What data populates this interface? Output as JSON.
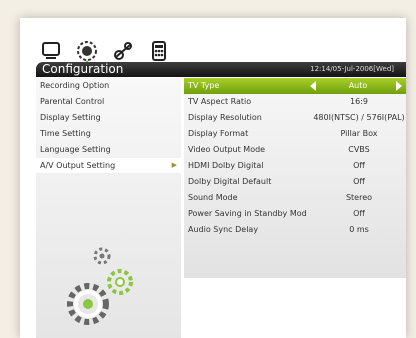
{
  "header": {
    "title": "Configuration",
    "datetime": "12:14/05-Jul-2006[Wed]"
  },
  "icons": [
    "tv-icon",
    "satellite-dish-icon",
    "settings-gear-icon",
    "calculator-icon"
  ],
  "left_menu": {
    "items": [
      {
        "label": "Recording Option"
      },
      {
        "label": "Parental Control"
      },
      {
        "label": "Display Setting"
      },
      {
        "label": "Time Setting"
      },
      {
        "label": "Language Setting"
      },
      {
        "label": "A/V Output Setting",
        "active": true,
        "arrow": "▶"
      }
    ]
  },
  "settings": {
    "rows": [
      {
        "label": "TV Type",
        "value": "Auto",
        "selected": true
      },
      {
        "label": "TV Aspect Ratio",
        "value": "16:9"
      },
      {
        "label": "Display Resolution",
        "value": "480I(NTSC) / 576I(PAL)"
      },
      {
        "label": "Display Format",
        "value": "Pillar Box"
      },
      {
        "label": "Video Output Mode",
        "value": "CVBS"
      },
      {
        "label": "HDMI Dolby Digital",
        "value": "Off"
      },
      {
        "label": "Dolby Digital Default",
        "value": "Off"
      },
      {
        "label": "Sound Mode",
        "value": "Stereo"
      },
      {
        "label": "Power Saving in Standby Mod",
        "value": "Off"
      },
      {
        "label": "Audio Sync Delay",
        "value": "0 ms"
      }
    ]
  },
  "colors": {
    "selection_green": "#8cc224",
    "gear_green": "#8cc63f",
    "title_bar": "#202020"
  }
}
